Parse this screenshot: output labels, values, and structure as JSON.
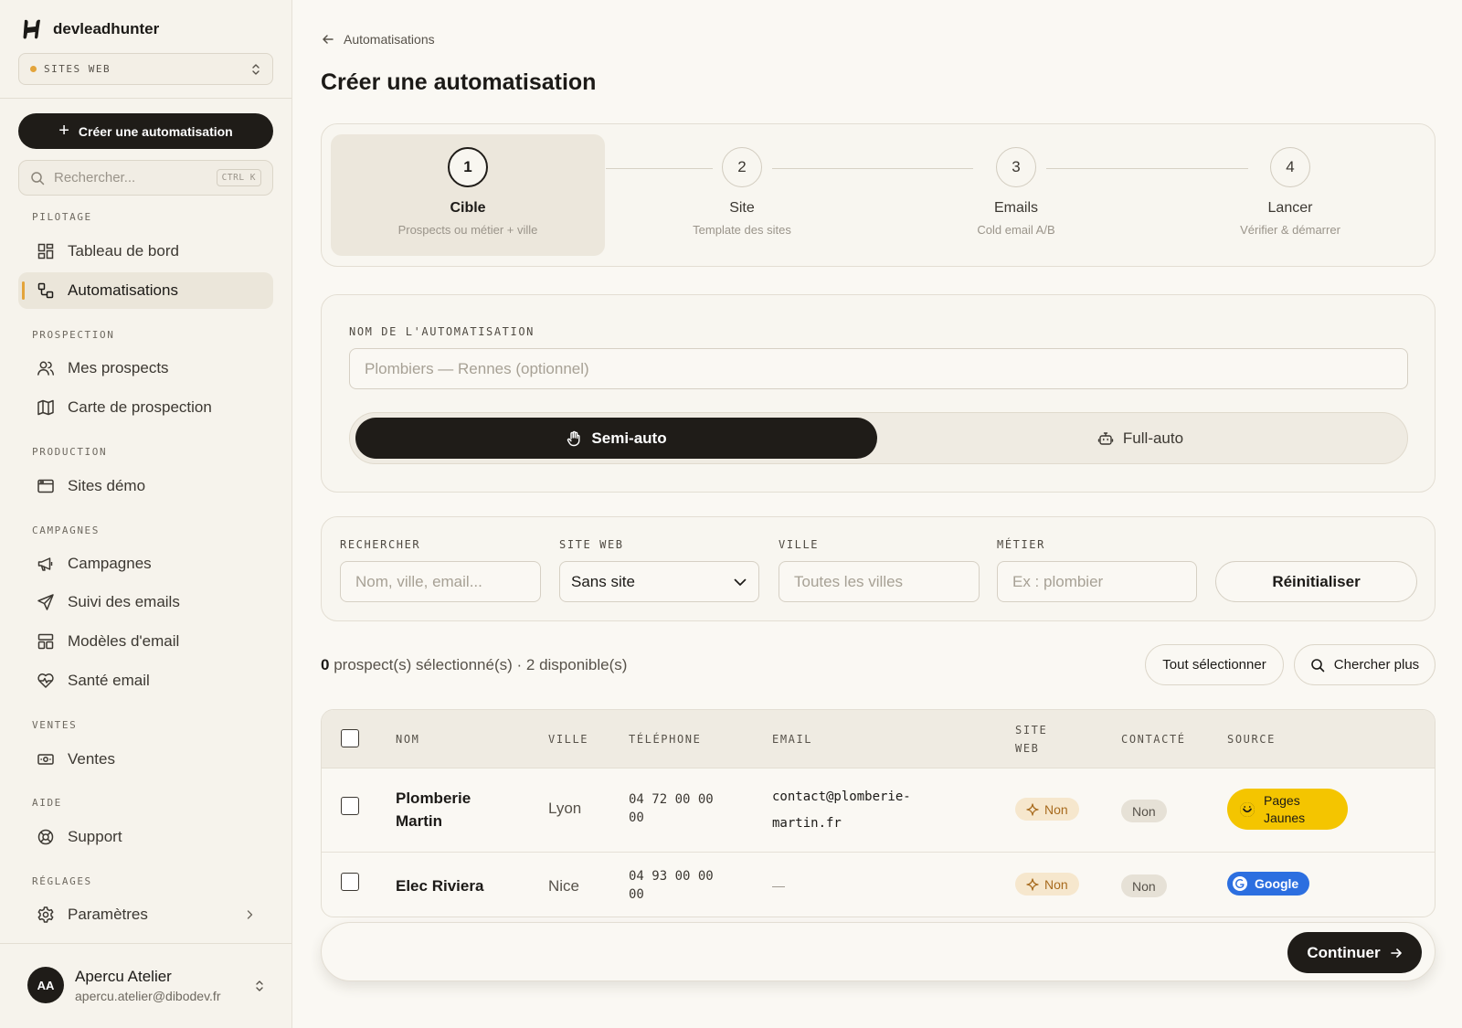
{
  "app": {
    "name": "devleadhunter"
  },
  "workspace": {
    "label": "SITES WEB",
    "dot_color": "#e3a43b"
  },
  "sidebar": {
    "create_label": "Créer une automatisation",
    "search_placeholder": "Rechercher...",
    "search_shortcut": "CTRL K",
    "sections": {
      "pilotage": "PILOTAGE",
      "prospection": "PROSPECTION",
      "production": "PRODUCTION",
      "campagnes": "CAMPAGNES",
      "ventes": "VENTES",
      "aide": "AIDE",
      "reglages": "RÉGLAGES"
    },
    "items": {
      "dashboard": "Tableau de bord",
      "automations": "Automatisations",
      "prospects": "Mes prospects",
      "map": "Carte de prospection",
      "demo_sites": "Sites démo",
      "campaigns": "Campagnes",
      "email_tracking": "Suivi des emails",
      "email_templates": "Modèles d'email",
      "email_health": "Santé email",
      "sales": "Ventes",
      "support": "Support",
      "settings": "Paramètres"
    },
    "active_item": "automations"
  },
  "user": {
    "initials": "AA",
    "name": "Apercu Atelier",
    "email": "apercu.atelier@dibodev.fr"
  },
  "header": {
    "back_label": "Automatisations",
    "title": "Créer une automatisation"
  },
  "steps": [
    {
      "num": "1",
      "name": "Cible",
      "sub": "Prospects ou métier + ville",
      "active": true
    },
    {
      "num": "2",
      "name": "Site",
      "sub": "Template des sites",
      "active": false
    },
    {
      "num": "3",
      "name": "Emails",
      "sub": "Cold email A/B",
      "active": false
    },
    {
      "num": "4",
      "name": "Lancer",
      "sub": "Vérifier & démarrer",
      "active": false
    }
  ],
  "form": {
    "name_label": "NOM DE L'AUTOMATISATION",
    "name_placeholder": "Plombiers — Rennes (optionnel)",
    "mode_semi": "Semi-auto",
    "mode_full": "Full-auto",
    "selected_mode": "Semi-auto"
  },
  "filters": {
    "search_label": "RECHERCHER",
    "search_placeholder": "Nom, ville, email...",
    "site_label": "SITE WEB",
    "site_value": "Sans site",
    "city_label": "VILLE",
    "city_placeholder": "Toutes les villes",
    "trade_label": "MÉTIER",
    "trade_placeholder": "Ex : plombier",
    "reset_label": "Réinitialiser"
  },
  "selection": {
    "count": "0",
    "text": "prospect(s) sélectionné(s) · 2 disponible(s)",
    "select_all": "Tout sélectionner",
    "search_more": "Chercher plus"
  },
  "table": {
    "headers": {
      "name": "NOM",
      "city": "VILLE",
      "phone": "TÉLÉPHONE",
      "email": "EMAIL",
      "site_1": "SITE",
      "site_2": "WEB",
      "contacted": "CONTACTÉ",
      "source": "SOURCE"
    },
    "rows": [
      {
        "name_1": "Plomberie",
        "name_2": "Martin",
        "city": "Lyon",
        "phone_1": "04 72 00 00",
        "phone_2": "00",
        "email_1": "contact@plomberie-",
        "email_2": "martin.fr",
        "site": "Non",
        "contacted": "Non",
        "source_1": "Pages",
        "source_2": "Jaunes",
        "source_color": "#f4c500"
      },
      {
        "name_1": "Elec Riviera",
        "city": "Nice",
        "phone_1": "04 93 00 00",
        "phone_2": "00",
        "email_1": "—",
        "site": "Non",
        "contacted": "Non",
        "source_1": "Google",
        "source_color": "#2c6fe0"
      }
    ]
  },
  "footer": {
    "continue_label": "Continuer"
  }
}
